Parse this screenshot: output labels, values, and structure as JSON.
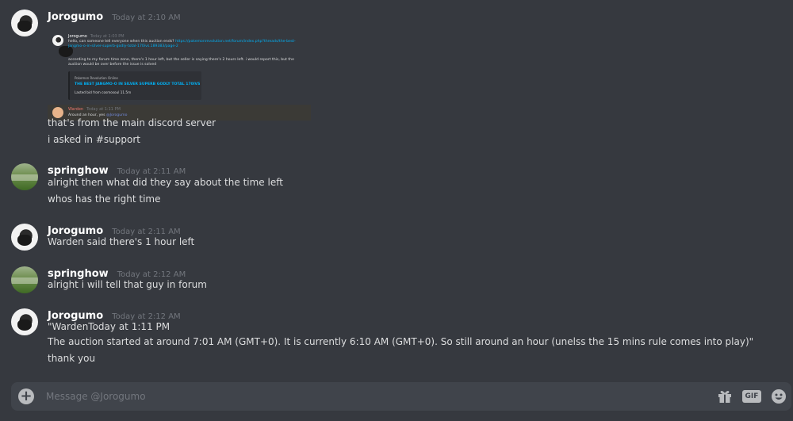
{
  "messages": [
    {
      "author": "Jorogumo",
      "timestamp": "Today at 2:10 AM",
      "embed": {
        "author": "Jorogumo",
        "timestamp": "Today at 1:03 PM",
        "line1_prefix": "hello, can someone tell everyone when this auction ends?",
        "line1_link": "https://pokemonrevolution.net/forum/index.php?threads/the-best-",
        "line2_link": "jangmo-o-in-silver-superb-godly-total-170ivs.189383/page-2",
        "line3": "according to my forum time zone, there's 1 hour left, but the seller is saying there's 2 hours left. i would report this, but the",
        "line4": "auction would be over before the issue is solved",
        "card_source": "Pokemon Revolution Online",
        "card_title": "THE BEST JANGMO-O IN SILVER SUPERB GODLY TOTAL 170IVS",
        "card_desc": "Lasted bid from cosmosoul 11.5m",
        "reply_author": "Warden",
        "reply_timestamp": "Today at 1:11 PM",
        "reply_text": "Around an hour, yes",
        "reply_mention": "@Jorogumo"
      },
      "lines": [
        "that's from the main discord server",
        "i asked in #support"
      ]
    },
    {
      "author": "springhow",
      "timestamp": "Today at 2:11 AM",
      "lines": [
        "alright then what did they say about the time left",
        "whos has the right time"
      ]
    },
    {
      "author": "Jorogumo",
      "timestamp": "Today at 2:11 AM",
      "lines": [
        "Warden said there's 1 hour left"
      ]
    },
    {
      "author": "springhow",
      "timestamp": "Today at 2:12 AM",
      "lines": [
        "alright i will tell that guy in forum"
      ]
    },
    {
      "author": "Jorogumo",
      "timestamp": "Today at 2:12 AM",
      "lines": [
        "\"WardenToday at 1:11 PM",
        "The auction started at around 7:01 AM (GMT+0). It is currently 6:10 AM (GMT+0). So still around an hour (unelss the 15 mins rule comes into play)\"",
        "thank you"
      ]
    }
  ],
  "composer": {
    "placeholder": "Message @Jorogumo",
    "gif_label": "GIF",
    "add_icon": "plus-circle-icon",
    "gift_icon": "gift-icon",
    "emoji_icon": "emoji-icon"
  },
  "colors": {
    "background": "#36393f",
    "composer": "#40444b",
    "username": "#ffffff",
    "timestamp": "#72767d",
    "text": "#dcddde",
    "link": "#00b0f4",
    "mention": "#7289da"
  }
}
